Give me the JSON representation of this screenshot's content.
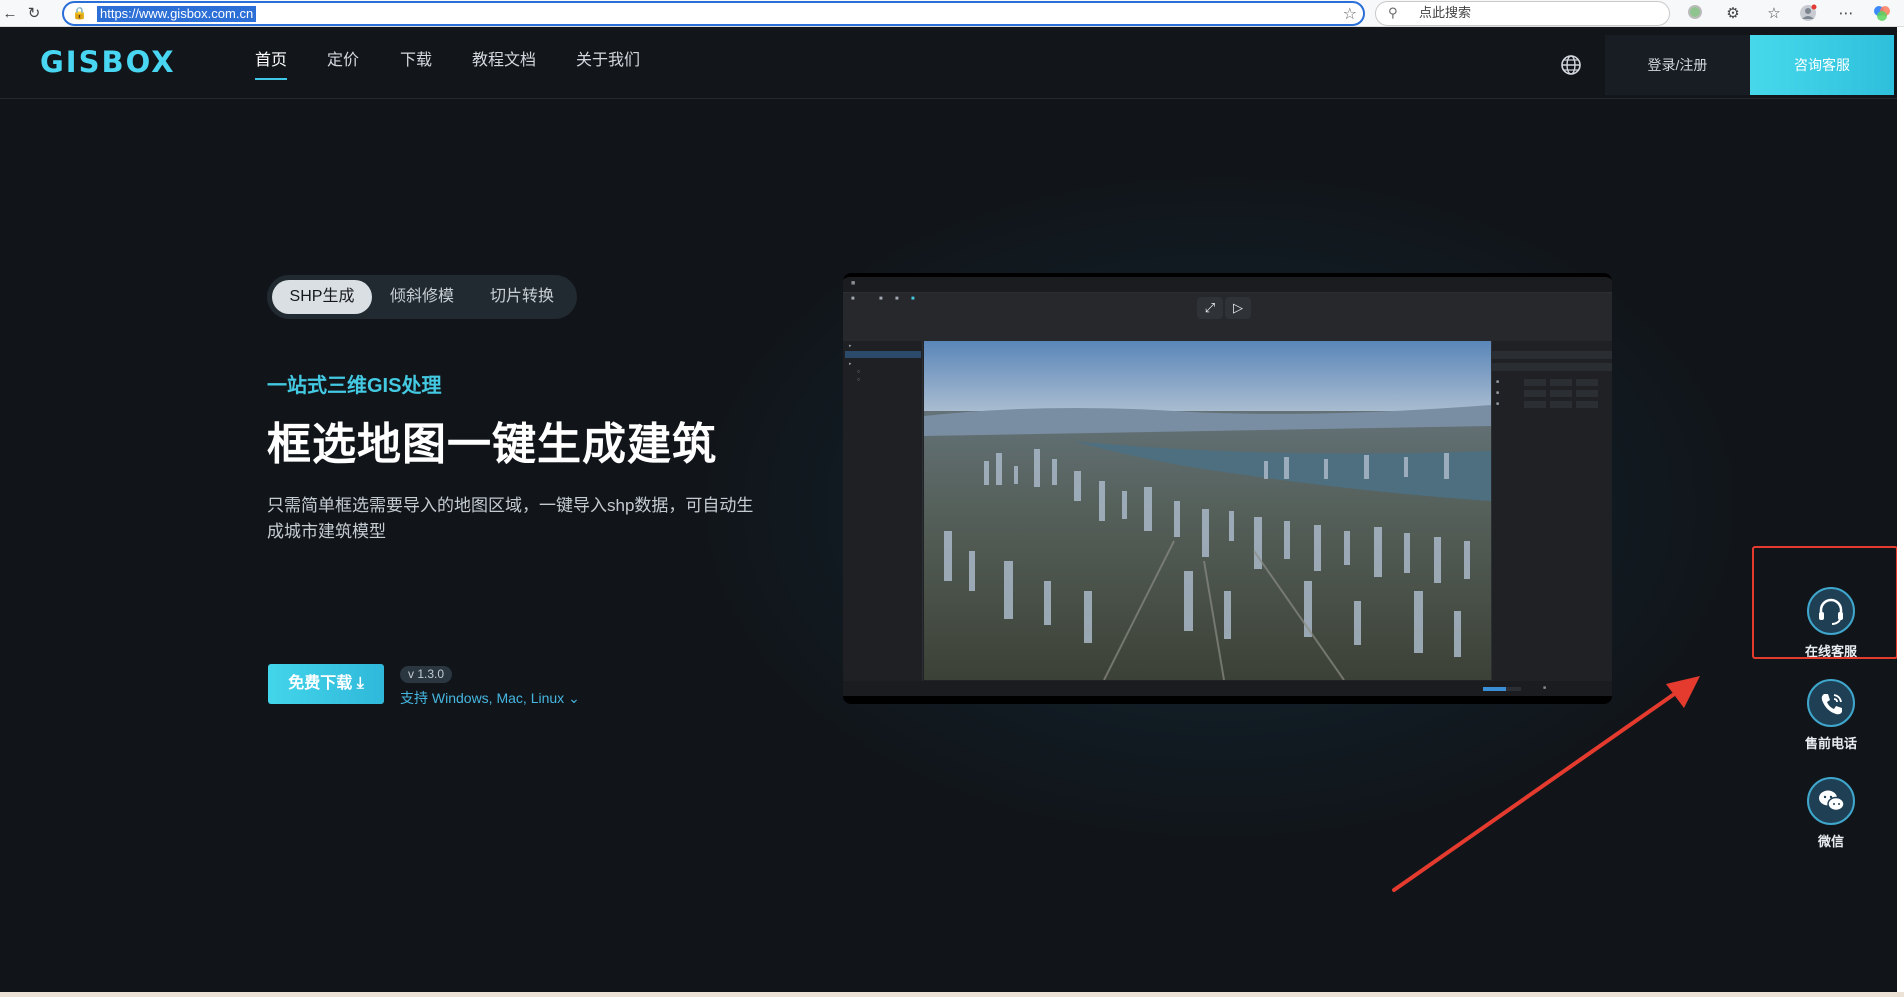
{
  "browser": {
    "url": "https://www.gisbox.com.cn",
    "search_placeholder": "点此搜索"
  },
  "header": {
    "logo": "GISBOX",
    "nav": [
      "首页",
      "定价",
      "下载",
      "教程文档",
      "关于我们"
    ],
    "login": "登录/注册",
    "consult": "咨询客服"
  },
  "hero": {
    "tabs": [
      "SHP生成",
      "倾斜修模",
      "切片转换"
    ],
    "eyebrow": "一站式三维GIS处理",
    "title": "框选地图一键生成建筑",
    "description": "只需简单框选需要导入的地图区域，一键导入shp数据，可自动生成城市建筑模型",
    "download_button": "免费下载",
    "version": "v 1.3.0",
    "platforms": "支持 Windows, Mac, Linux"
  },
  "float_service": {
    "items": [
      {
        "label": "在线客服",
        "icon": "headset-icon"
      },
      {
        "label": "售前电话",
        "icon": "phone-icon"
      },
      {
        "label": "微信",
        "icon": "wechat-icon"
      }
    ]
  },
  "colors": {
    "accent": "#44c9e2",
    "page_bg": "#11151a",
    "annotation": "#e53a2e"
  }
}
